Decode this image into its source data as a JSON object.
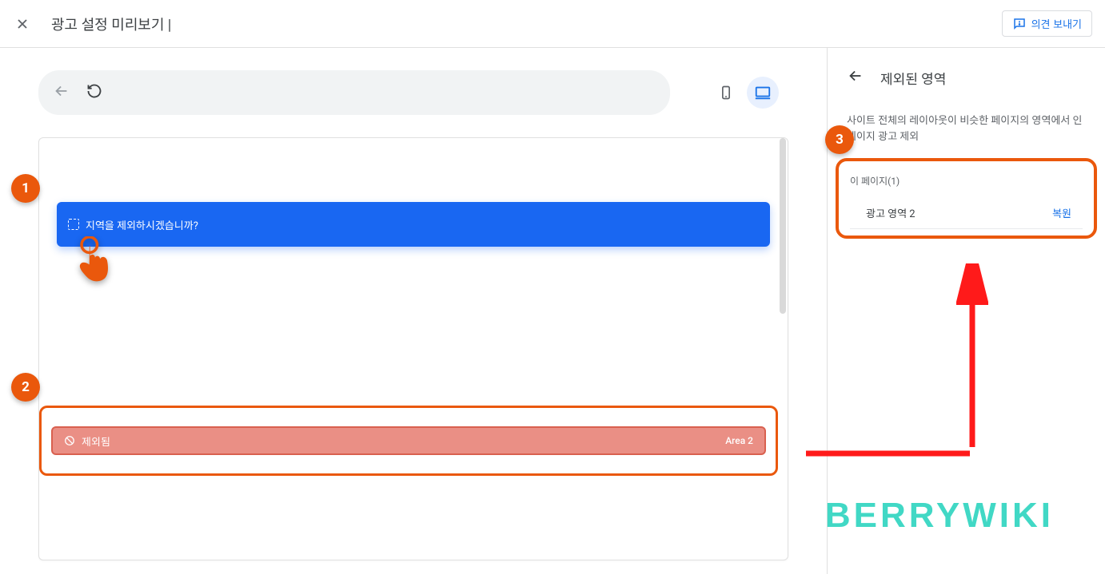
{
  "header": {
    "title": "광고 설정 미리보기 |",
    "feedback_label": "의견 보내기"
  },
  "toolbar": {
    "url_value": ""
  },
  "preview": {
    "blue_bar_label": "지역을 제외하시겠습니까?",
    "excluded_bar_label": "제외됨",
    "excluded_bar_area": "Area 2"
  },
  "callouts": [
    "1",
    "2",
    "3"
  ],
  "sidebar": {
    "title": "제외된 영역",
    "description": "사이트 전체의 레이아웃이 비슷한 페이지의 영역에서 인페이지 광고 제외",
    "card_title": "이 페이지(1)",
    "items": [
      {
        "name": "광고 영역 2",
        "action": "복원"
      }
    ]
  },
  "watermark": "BERRYWIKI"
}
